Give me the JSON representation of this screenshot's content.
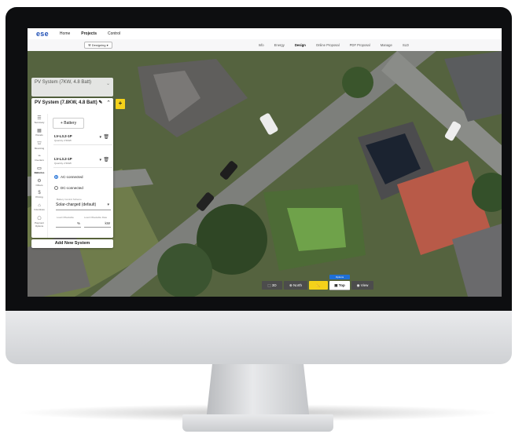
{
  "app": {
    "logo": "ese",
    "nav": [
      "Home",
      "Projects",
      "Control"
    ],
    "designing_button": "Designing"
  },
  "tabs": [
    {
      "label": "Info",
      "active": false
    },
    {
      "label": "Energy",
      "active": false
    },
    {
      "label": "Design",
      "active": true
    },
    {
      "label": "Online Proposal",
      "active": false
    },
    {
      "label": "PDF Proposal",
      "active": false
    },
    {
      "label": "Manage",
      "active": false
    },
    {
      "label": "SLD",
      "active": false
    }
  ],
  "panel": {
    "collapsed_title": "PV System (7KW, 4.8 Batt)",
    "title": "PV System (7.8KW, 4.8 Batt)",
    "side_icons": [
      "Summary",
      "Panels",
      "Mounting",
      "Inverters",
      "Batteries",
      "Others",
      "Pricing",
      "Incentives",
      "Payment Options"
    ],
    "battery_button": "Battery",
    "batteries": [
      {
        "name": "LV-L3.2-1P",
        "qty": "Quantity 2.5kWh"
      },
      {
        "name": "LV-L3.2-1P",
        "qty": "Quantity 2.5kWh"
      }
    ],
    "coupling": {
      "ac": "AC-connected",
      "dc": "DC-connected",
      "selected": "ac"
    },
    "control_label": "Battery Control Scheme",
    "control_value": "Solar-charged (default)",
    "load_offset_label": "Load Offsettable",
    "load_offset_unit": "%",
    "load_power_label": "Load Offsettable Rate",
    "load_power_unit": "kW",
    "add_system": "Add New System"
  },
  "toolbar": {
    "options_caption": "Options",
    "buttons": [
      "3D",
      "North",
      "Top",
      "View"
    ],
    "selected": "Top"
  },
  "colors": {
    "brand": "#1f4fb5",
    "accent_yellow": "#f4d21a",
    "selected_blue": "#1f6fd6"
  }
}
